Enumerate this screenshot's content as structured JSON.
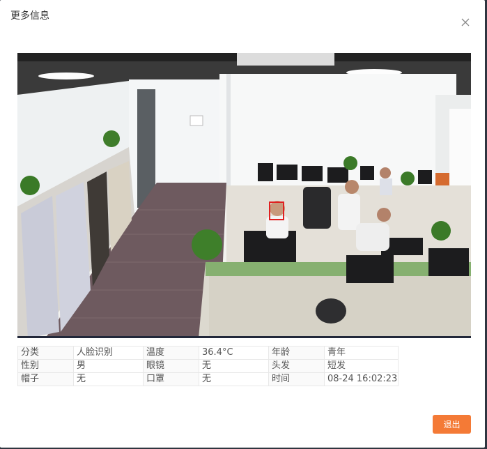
{
  "dialog": {
    "title": "更多信息",
    "close_icon": "close-icon"
  },
  "photo": {
    "scene": "office surveillance snapshot",
    "detection_box_color": "#e02020"
  },
  "info": {
    "rows": [
      [
        {
          "label": "分类",
          "value": "人脸识别"
        },
        {
          "label": "温度",
          "value": "36.4°C"
        },
        {
          "label": "年龄",
          "value": "青年"
        }
      ],
      [
        {
          "label": "性别",
          "value": "男"
        },
        {
          "label": "眼镜",
          "value": "无"
        },
        {
          "label": "头发",
          "value": "短发"
        }
      ],
      [
        {
          "label": "帽子",
          "value": "无"
        },
        {
          "label": "口罩",
          "value": "无"
        },
        {
          "label": "时间",
          "value": "08-24 16:02:23"
        }
      ]
    ]
  },
  "footer": {
    "exit_label": "退出",
    "exit_color": "#f47a36"
  }
}
